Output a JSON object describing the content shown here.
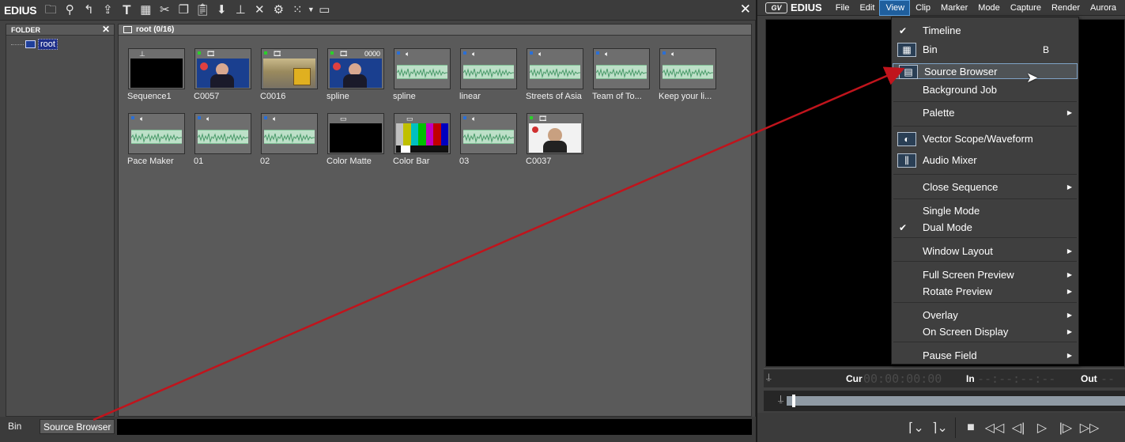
{
  "bin": {
    "app_title": "EDIUS",
    "toolbar_icons": [
      "folder-icon",
      "search-icon",
      "up-icon",
      "import-icon",
      "title-icon",
      "color-icon",
      "cut-icon",
      "copy-icon",
      "paste-icon",
      "add-icon",
      "timeline-add-icon",
      "delete-icon",
      "properties-icon",
      "view-icon",
      "dropdown-arrow-icon",
      "settings-icon"
    ],
    "close": "✕",
    "folder_pane": {
      "title": "FOLDER",
      "close": "✕",
      "root": "root"
    },
    "clip_pane": {
      "title": "root (0/16)"
    },
    "clips": [
      {
        "name": "Sequence1",
        "kind": "sequence"
      },
      {
        "name": "C0057",
        "kind": "video-anchor"
      },
      {
        "name": "C0016",
        "kind": "video-train"
      },
      {
        "name": "spline",
        "kind": "video-anchor",
        "badge": "0000"
      },
      {
        "name": "spline",
        "kind": "audio"
      },
      {
        "name": "linear",
        "kind": "audio"
      },
      {
        "name": "Streets of Asia",
        "kind": "audio"
      },
      {
        "name": "Team of To...",
        "kind": "audio"
      },
      {
        "name": "Keep your li...",
        "kind": "audio"
      },
      {
        "name": "Pace Maker",
        "kind": "audio"
      },
      {
        "name": "01",
        "kind": "audio"
      },
      {
        "name": "02",
        "kind": "audio"
      },
      {
        "name": "Color Matte",
        "kind": "matte"
      },
      {
        "name": "Color Bar",
        "kind": "colorbar"
      },
      {
        "name": "03",
        "kind": "audio"
      },
      {
        "name": "C0037",
        "kind": "video-woman"
      }
    ],
    "tabs": {
      "bin": "Bin",
      "source_browser": "Source Browser"
    }
  },
  "player": {
    "logo_badge": "GV",
    "app_title": "EDIUS",
    "menu": [
      "File",
      "Edit",
      "View",
      "Clip",
      "Marker",
      "Mode",
      "Capture",
      "Render",
      "Aurora"
    ],
    "active_menu": "View",
    "timecode": {
      "cur_label": "Cur",
      "cur_value": "00:00:00:00",
      "in_label": "In",
      "in_value": "--:--:--:--",
      "out_label": "Out",
      "out_value": "--"
    }
  },
  "view_menu": {
    "items": [
      {
        "label": "Timeline",
        "check": true
      },
      {
        "label": "Bin",
        "icon": "bin-icon",
        "key": "B"
      },
      {
        "label": "Source Browser",
        "icon": "source-browser-icon",
        "highlight": true
      },
      {
        "label": "Background Job"
      },
      {
        "label": "Palette",
        "submenu": true
      },
      {
        "label": "Vector Scope/Waveform",
        "icon": "vectorscope-icon"
      },
      {
        "label": "Audio Mixer",
        "icon": "audio-mixer-icon"
      },
      {
        "label": "Close Sequence",
        "submenu": true
      },
      {
        "label": "Single Mode"
      },
      {
        "label": "Dual Mode",
        "check": true
      },
      {
        "label": "Window Layout",
        "submenu": true
      },
      {
        "label": "Full Screen Preview",
        "submenu": true
      },
      {
        "label": "Rotate Preview",
        "submenu": true
      },
      {
        "label": "Overlay",
        "submenu": true
      },
      {
        "label": "On Screen Display",
        "submenu": true
      },
      {
        "label": "Pause Field",
        "submenu": true
      }
    ]
  },
  "colors": {
    "highlight": "#1f5f9e",
    "annotation_arrow": "#c0141c",
    "waveform": "#bde0c8"
  }
}
